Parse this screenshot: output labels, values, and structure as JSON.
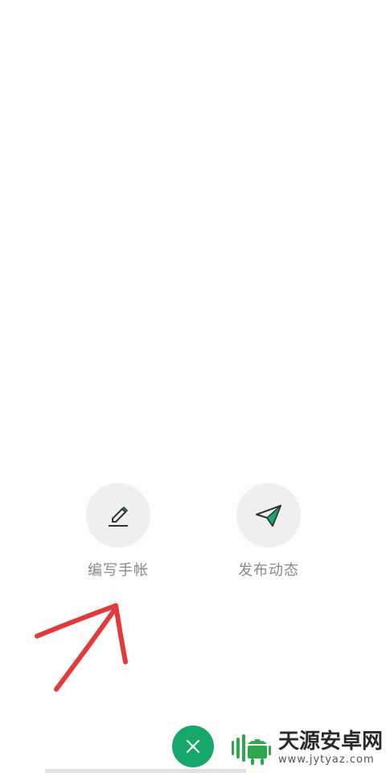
{
  "actions": {
    "write_journal": {
      "label": "编写手帐",
      "icon": "pencil-icon"
    },
    "publish_post": {
      "label": "发布动态",
      "icon": "paper-plane-icon"
    }
  },
  "close_button": {
    "icon": "close-icon",
    "color": "#16a86a"
  },
  "annotation": {
    "color": "#e03a3a",
    "type": "hand-drawn-arrow"
  },
  "watermark": {
    "title": "天源安卓网",
    "url": "www.jytyaz.com",
    "icon": "android-logo"
  }
}
